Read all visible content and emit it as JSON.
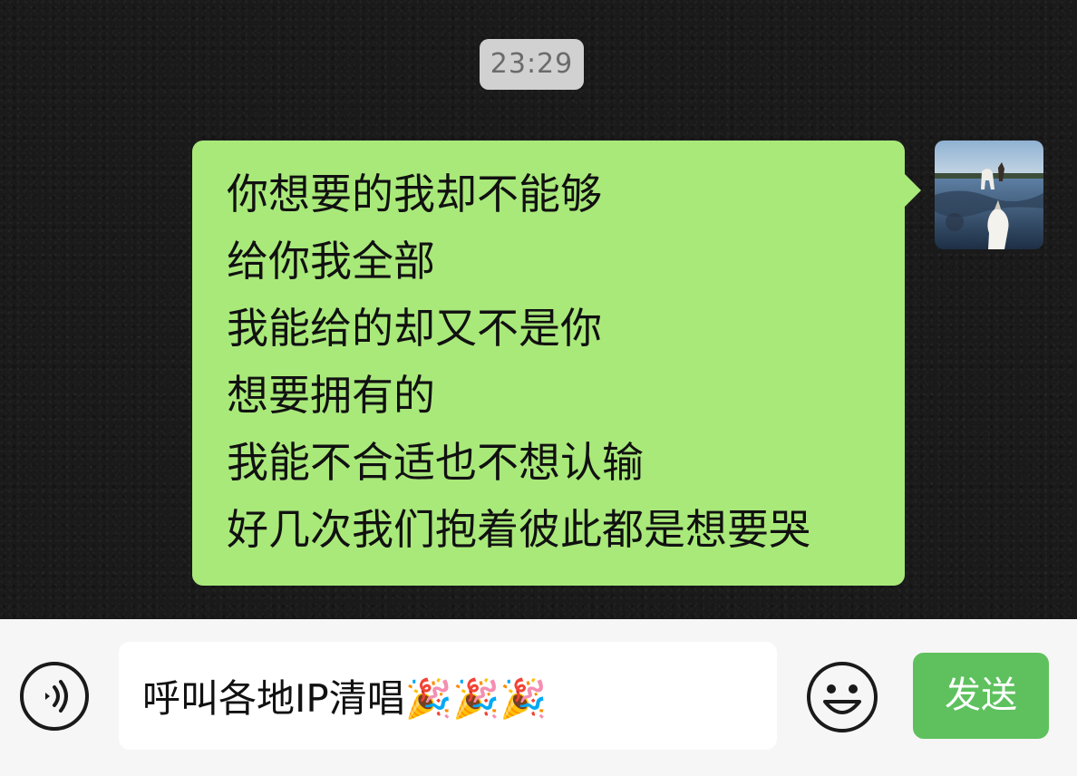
{
  "chat": {
    "timestamp": "23:29",
    "message": {
      "lines": [
        "你想要的我却不能够",
        "给你我全部",
        "我能给的却又不是你",
        "想要拥有的",
        "我能不合适也不想认输",
        "好几次我们抱着彼此都是想要哭"
      ]
    },
    "avatar_icon": "avatar-photo-beach-horse"
  },
  "composer": {
    "voice_icon": "voice-icon",
    "input_value": "呼叫各地IP清唱🎉🎉🎉",
    "emoji_icon": "emoji-icon",
    "send_label": "发送"
  },
  "colors": {
    "bubble": "#a9e97a",
    "send_button": "#5ec15e",
    "background": "#1a1a1a",
    "timestamp_bg": "#d1d1d1"
  }
}
